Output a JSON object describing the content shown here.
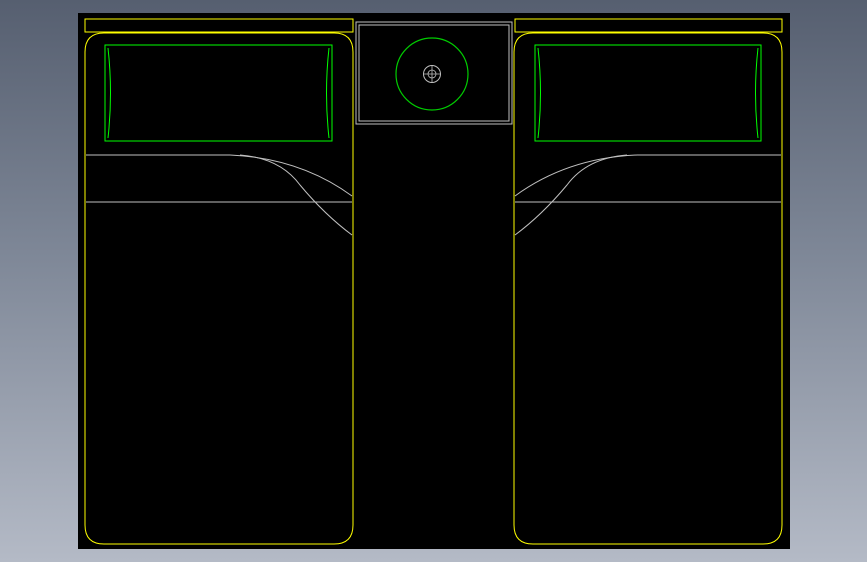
{
  "drawing": {
    "colors": {
      "background_gradient_top": "#565f70",
      "background_gradient_bottom": "#b4bac6",
      "paper": "#000000",
      "furniture_outline": "#ffff00",
      "pillow": "#00ff00",
      "lamp": "#00cc00",
      "detail": "#bfbfbf"
    },
    "layers": {
      "headboard": "furniture_outline",
      "bed_frame": "furniture_outline",
      "pillows": "pillow",
      "nightstand": "detail",
      "lamp": "lamp",
      "blanket_fold": "detail"
    }
  }
}
